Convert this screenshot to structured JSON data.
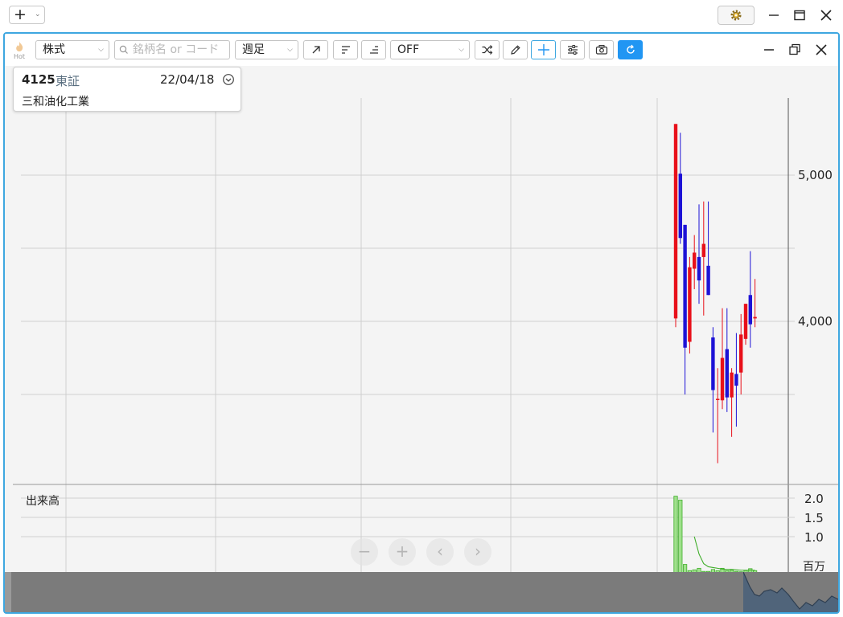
{
  "titlebar": {
    "add_icon": "plus-icon",
    "gear_icon": "gear-icon",
    "minimize_icon": "minimize-icon",
    "maximize_icon": "maximize-icon",
    "close_icon": "close-icon"
  },
  "toolbar": {
    "hot_label": "Hot",
    "asset_type": "株式",
    "search_placeholder": "銘柄名 or コード",
    "period": "週足",
    "indicator": "OFF",
    "icons": [
      "trend-line-icon",
      "align-left-icon",
      "align-right-icon",
      "shuffle-icon",
      "pencil-icon",
      "crosshair-icon",
      "sliders-icon",
      "camera-icon",
      "refresh-icon"
    ]
  },
  "window_controls": {
    "minimize_icon": "minimize-icon",
    "restore_icon": "restore-icon",
    "close_icon": "close-icon"
  },
  "info": {
    "code": "4125",
    "market": "東証",
    "date": "22/04/18",
    "name": "三和油化工業"
  },
  "volume_panel": {
    "title": "出来高",
    "unit": "百万"
  },
  "colors": {
    "up": "#e8101a",
    "down": "#1d12d6",
    "volume": "#3fae2a",
    "accent": "#3ea7e0"
  },
  "chart_data": {
    "type": "candlestick",
    "price_axis": {
      "ticks": [
        4000,
        5000
      ],
      "tick_labels": [
        "4,000",
        "5,000"
      ],
      "gridlines": [
        3500,
        4000,
        4500,
        5000
      ],
      "range": [
        3100,
        5500
      ]
    },
    "volume_axis": {
      "ticks": [
        1.0,
        1.5,
        2.0
      ],
      "tick_labels": [
        "1.0",
        "1.5",
        "2.0"
      ],
      "range": [
        0,
        2.2
      ]
    },
    "candles": [
      {
        "o": 4020,
        "h": 5350,
        "l": 3960,
        "c": 5350
      },
      {
        "o": 5010,
        "h": 5290,
        "l": 4530,
        "c": 4570
      },
      {
        "o": 4660,
        "h": 4660,
        "l": 3500,
        "c": 3820
      },
      {
        "o": 3860,
        "h": 4440,
        "l": 3780,
        "c": 4370
      },
      {
        "o": 4360,
        "h": 4590,
        "l": 4220,
        "c": 4470
      },
      {
        "o": 4440,
        "h": 4800,
        "l": 4120,
        "c": 4280
      },
      {
        "o": 4440,
        "h": 4820,
        "l": 4040,
        "c": 4530
      },
      {
        "o": 4380,
        "h": 4820,
        "l": 4180,
        "c": 4180
      },
      {
        "o": 3890,
        "h": 3960,
        "l": 3240,
        "c": 3530
      },
      {
        "o": 3470,
        "h": 3680,
        "l": 3030,
        "c": 3470
      },
      {
        "o": 3460,
        "h": 4090,
        "l": 3400,
        "c": 3750
      },
      {
        "o": 3810,
        "h": 4090,
        "l": 3380,
        "c": 3480
      },
      {
        "o": 3480,
        "h": 3680,
        "l": 3210,
        "c": 3650
      },
      {
        "o": 3640,
        "h": 3920,
        "l": 3280,
        "c": 3560
      },
      {
        "o": 3650,
        "h": 4050,
        "l": 3500,
        "c": 3910
      },
      {
        "o": 3880,
        "h": 4120,
        "l": 3840,
        "c": 4120
      },
      {
        "o": 4180,
        "h": 4480,
        "l": 3820,
        "c": 3980
      },
      {
        "o": 4020,
        "h": 4290,
        "l": 3960,
        "c": 4030
      }
    ],
    "volume": [
      2.05,
      1.95,
      0.28,
      0.12,
      0.14,
      0.18,
      0.1,
      0.1,
      0.15,
      0.12,
      0.18,
      0.12,
      0.13,
      0.1,
      0.09,
      0.12,
      0.17,
      0.12
    ],
    "volume_avg": [
      null,
      null,
      null,
      null,
      1.0,
      0.55,
      0.3,
      0.22,
      0.2,
      0.18,
      0.16,
      0.15,
      0.15,
      0.14,
      0.13,
      0.13,
      0.13,
      0.13
    ]
  }
}
